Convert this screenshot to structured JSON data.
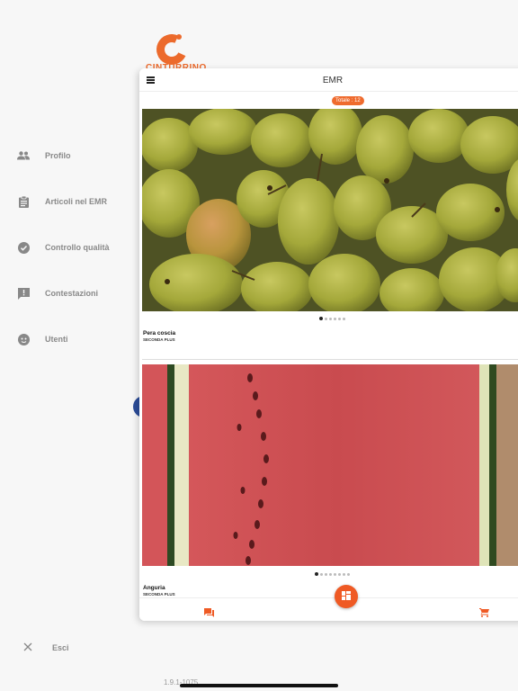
{
  "brand": {
    "name": "CINTURRINO",
    "color": "#ec6a2c"
  },
  "sidebar": {
    "items": [
      {
        "label": "Profilo",
        "icon": "people-icon"
      },
      {
        "label": "Articoli nel EMR",
        "icon": "clipboard-icon"
      },
      {
        "label": "Controllo qualità",
        "icon": "check-circle-icon"
      },
      {
        "label": "Contestazioni",
        "icon": "alert-message-icon"
      },
      {
        "label": "Utenti",
        "icon": "face-icon"
      }
    ],
    "logout_label": "Esci",
    "version": "1.9.1-1075"
  },
  "header": {
    "title": "EMR",
    "menu_icon": "hamburger-icon"
  },
  "badge": {
    "label": "Totale : 12",
    "color": "#ef6b2e"
  },
  "products": [
    {
      "name": "Pera coscia",
      "subtitle": "SECONDA PLUS",
      "image": "pears-photo",
      "dots": 6,
      "active_dot": 0
    },
    {
      "name": "Anguria",
      "subtitle": "SECONDA PLUS",
      "image": "watermelon-photo",
      "dots": 8,
      "active_dot": 0
    }
  ],
  "bottom_nav": {
    "left_icon": "chat-icon",
    "center_icon": "dashboard-icon",
    "right_icon": "cart-icon",
    "accent": "#ef5a24"
  }
}
